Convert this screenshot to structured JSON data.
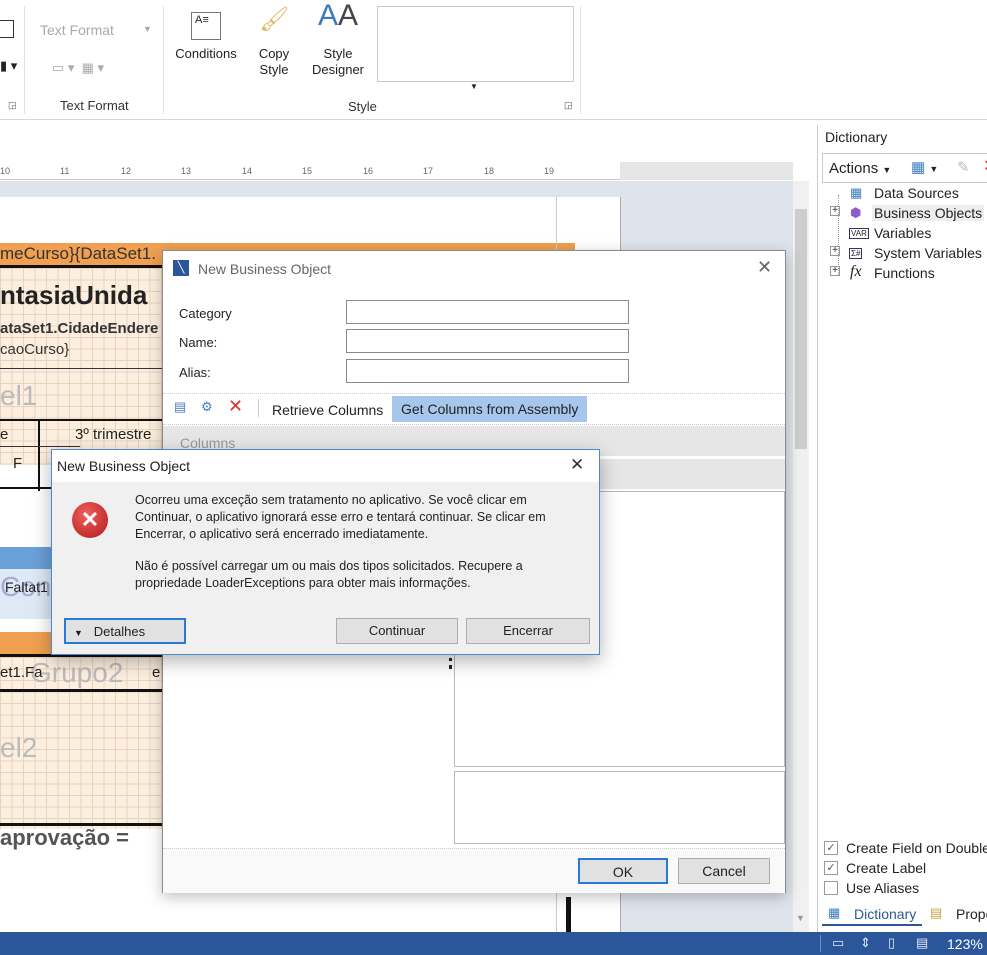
{
  "ribbon": {
    "text_format_combo": "Text Format",
    "text_format_group": "Text Format",
    "conditions": "Conditions",
    "copy_style": "Copy Style",
    "style_designer": "Style Designer",
    "style_group": "Style"
  },
  "ruler": [
    "10",
    "11",
    "12",
    "13",
    "14",
    "15",
    "16",
    "17",
    "18",
    "19"
  ],
  "report": {
    "header_band": "meCurso}{DataSet1.",
    "title": "ntasiaUnida",
    "line2": "ataSet1.CidadeEndere",
    "line3": "caoCurso}",
    "band_label1": "el1",
    "col_header": "e",
    "trimestre": "3º trimestre",
    "f_cell": "F",
    "faltat": "Faltat1",
    "band_label_con": "Con",
    "et1": "et1.Fa",
    "grupo2": "Grupo2",
    "e_cell": "e",
    "band_label2": "el2",
    "aprovacao": "aprovação ="
  },
  "dictionary": {
    "title": "Dictionary",
    "actions": "Actions",
    "tree": [
      "Data Sources",
      "Business Objects",
      "Variables",
      "System Variables",
      "Functions"
    ],
    "options": [
      {
        "label": "Create Field on Double C",
        "checked": true
      },
      {
        "label": "Create Label",
        "checked": true
      },
      {
        "label": "Use Aliases",
        "checked": false
      }
    ],
    "tabs": [
      "Dictionary",
      "Prope"
    ]
  },
  "status": {
    "zoom": "123%"
  },
  "nbo_dialog": {
    "title": "New Business Object",
    "category_label": "Category",
    "name_label": "Name:",
    "alias_label": "Alias:",
    "category_value": "",
    "name_value": "",
    "alias_value": "",
    "retrieve_columns": "Retrieve Columns",
    "get_columns": "Get Columns from Assembly",
    "columns_header": "Columns",
    "ok": "OK",
    "cancel": "Cancel"
  },
  "error_dialog": {
    "title": "New Business Object",
    "message1": "Ocorreu uma exceção sem tratamento no aplicativo. Se você clicar em Continuar, o aplicativo ignorará esse erro e tentará continuar. Se clicar em Encerrar, o aplicativo será encerrado imediatamente.",
    "message2": "Não é possível carregar um ou mais dos tipos solicitados. Recupere a propriedade LoaderExceptions para obter mais informações.",
    "details": "Detalhes",
    "continue": "Continuar",
    "quit": "Encerrar"
  }
}
